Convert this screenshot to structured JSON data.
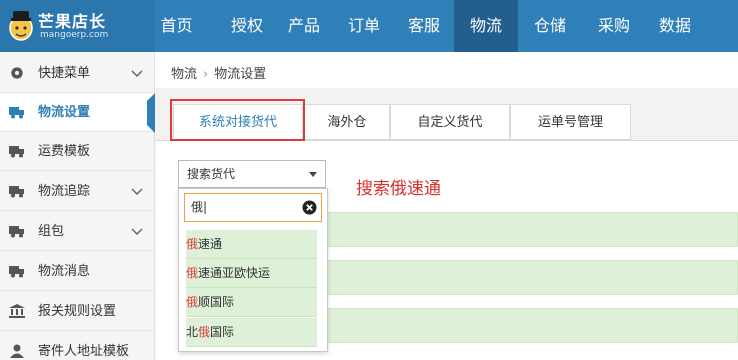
{
  "brand": {
    "title": "芒果店长",
    "subtitle": "mangoerp.com"
  },
  "nav": [
    {
      "label": "首页"
    },
    {
      "label": "授权"
    },
    {
      "label": "产品"
    },
    {
      "label": "订单"
    },
    {
      "label": "客服"
    },
    {
      "label": "物流"
    },
    {
      "label": "仓储"
    },
    {
      "label": "采购"
    },
    {
      "label": "数据"
    }
  ],
  "sidebar": {
    "items": [
      {
        "label": "快捷菜单",
        "icon": "gear-icon",
        "has_chevron": true
      },
      {
        "label": "物流设置",
        "icon": "truck-icon",
        "active": true
      },
      {
        "label": "运费模板",
        "icon": "truck-icon"
      },
      {
        "label": "物流追踪",
        "icon": "truck-icon",
        "has_chevron": true
      },
      {
        "label": "组包",
        "icon": "truck-icon",
        "has_chevron": true
      },
      {
        "label": "物流消息",
        "icon": "truck-icon"
      },
      {
        "label": "报关规则设置",
        "icon": "bank-icon"
      },
      {
        "label": "寄件人地址模板",
        "icon": "person-icon"
      }
    ]
  },
  "breadcrumb": {
    "root": "物流",
    "current": "物流设置"
  },
  "tabs": [
    {
      "label": "系统对接货代",
      "active": true
    },
    {
      "label": "海外仓"
    },
    {
      "label": "自定义货代"
    },
    {
      "label": "运单号管理"
    }
  ],
  "select": {
    "value": "搜索货代"
  },
  "search": {
    "value": "俄"
  },
  "options": [
    {
      "hit": "俄",
      "rest": "速通",
      "prefix": ""
    },
    {
      "hit": "俄",
      "rest": "速通亚欧快运",
      "prefix": ""
    },
    {
      "hit": "俄",
      "rest": "顺国际",
      "prefix": ""
    },
    {
      "hit": "俄",
      "rest": "国际",
      "prefix": "北"
    }
  ],
  "annotation": "搜索俄速通",
  "colors": {
    "topbar": "#2f7fb8",
    "active_nav": "#235f8e",
    "highlight": "#e03a3a",
    "match": "#d9413c",
    "row": "#dff0d8"
  }
}
